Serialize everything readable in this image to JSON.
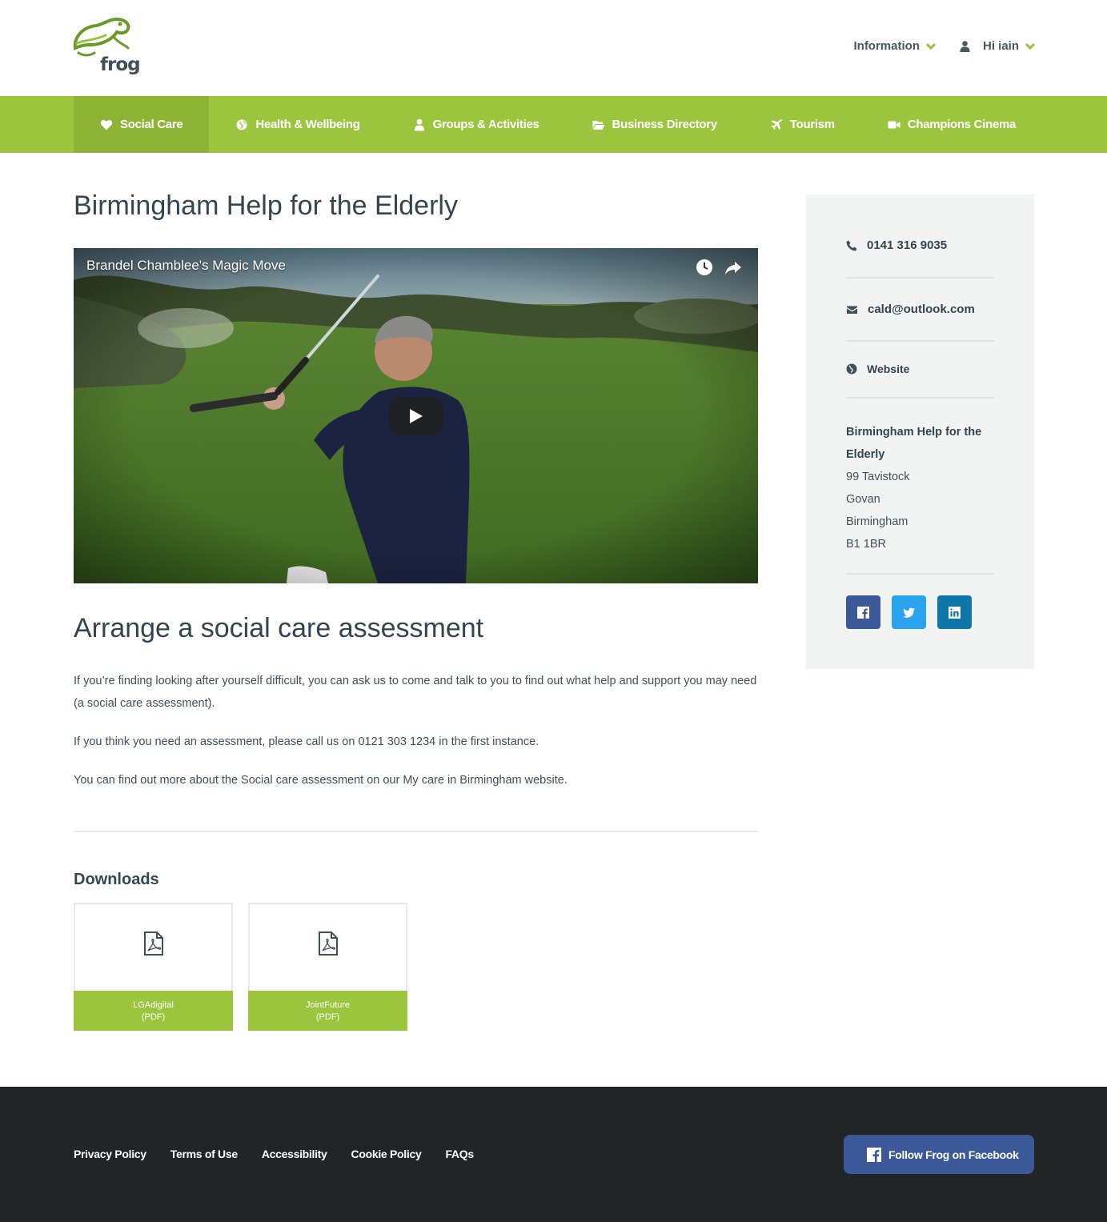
{
  "brand": {
    "logo_text": "frog",
    "accent": "#9bc53d",
    "dark": "#212526"
  },
  "topnav": {
    "information": "Information",
    "user": "Hi iain"
  },
  "mainnav": [
    {
      "label": "Social Care",
      "icon": "heart-icon"
    },
    {
      "label": "Health & Wellbeing",
      "icon": "globe-icon"
    },
    {
      "label": "Groups & Activities",
      "icon": "user-icon"
    },
    {
      "label": "Business Directory",
      "icon": "folder-open-icon"
    },
    {
      "label": "Tourism",
      "icon": "plane-icon"
    },
    {
      "label": "Champions Cinema",
      "icon": "video-camera-icon"
    }
  ],
  "page": {
    "title": "Birmingham Help for the Elderly",
    "video_title": "Brandel Chamblee's Magic Move",
    "section_title": "Arrange a social care assessment",
    "paragraphs": [
      "If you’re finding looking after yourself difficult, you can ask us to come and talk to you to find out what help and support you may need (a social care assessment).",
      "If you think you need an assessment, please call us on 0121 303 1234 in the first instance.",
      "You can find out more about the Social care assessment on our My care in Birmingham website."
    ],
    "downloads_title": "Downloads",
    "downloads": [
      {
        "name": "LGAdigital",
        "type": "(PDF)"
      },
      {
        "name": "JointFuture",
        "type": "(PDF)"
      }
    ]
  },
  "sidebar": {
    "phone": "0141 316 9035",
    "email": "cald@outlook.com",
    "website": "Website",
    "address": {
      "name": "Birmingham Help for the Elderly",
      "line1": "99 Tavistock",
      "line2": "Govan",
      "line3": "Birmingham",
      "postcode": "B1 1BR"
    },
    "social": [
      {
        "name": "facebook",
        "color": "#3b5998"
      },
      {
        "name": "twitter",
        "color": "#2aa3ef"
      },
      {
        "name": "linkedin",
        "color": "#0e76a8"
      }
    ]
  },
  "footer": {
    "links": [
      "Privacy Policy",
      "Terms of Use",
      "Accessibility",
      "Cookie Policy",
      "FAQs"
    ],
    "facebook_button": "Follow Frog on Facebook"
  }
}
